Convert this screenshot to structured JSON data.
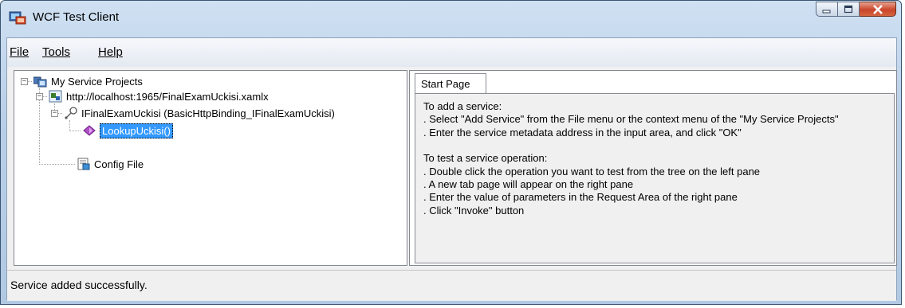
{
  "window": {
    "title": "WCF Test Client"
  },
  "menu": {
    "file": "File",
    "tools": "Tools",
    "help": "Help"
  },
  "tree": {
    "root": "My Service Projects",
    "service_url": "http://localhost:1965/FinalExamUckisi.xamlx",
    "contract": "IFinalExamUckisi (BasicHttpBinding_IFinalExamUckisi)",
    "operation": "LookupUckisi()",
    "config_file": "Config File"
  },
  "tabs": {
    "start_page": "Start Page"
  },
  "start_page": {
    "add_heading": "To add a service:",
    "add_line1": ". Select \"Add Service\" from the File menu or the context menu of the \"My Service Projects\"",
    "add_line2": ". Enter the service metadata address in the input area, and click \"OK\"",
    "test_heading": "To test a service operation:",
    "test_line1": ". Double click the operation you want to test from the tree on the left pane",
    "test_line2": ". A new tab page will appear on the right pane",
    "test_line3": ". Enter the value of parameters in the Request Area of the right pane",
    "test_line4": ". Click \"Invoke\" button"
  },
  "status": {
    "message": "Service added successfully."
  },
  "icons": {
    "app": "wcf-app-icon",
    "minimize": "minimize-icon",
    "maximize": "maximize-icon",
    "close": "close-icon",
    "projects": "service-projects-icon",
    "service": "service-endpoint-icon",
    "contract": "contract-icon",
    "operation": "operation-icon",
    "config": "config-file-icon"
  }
}
